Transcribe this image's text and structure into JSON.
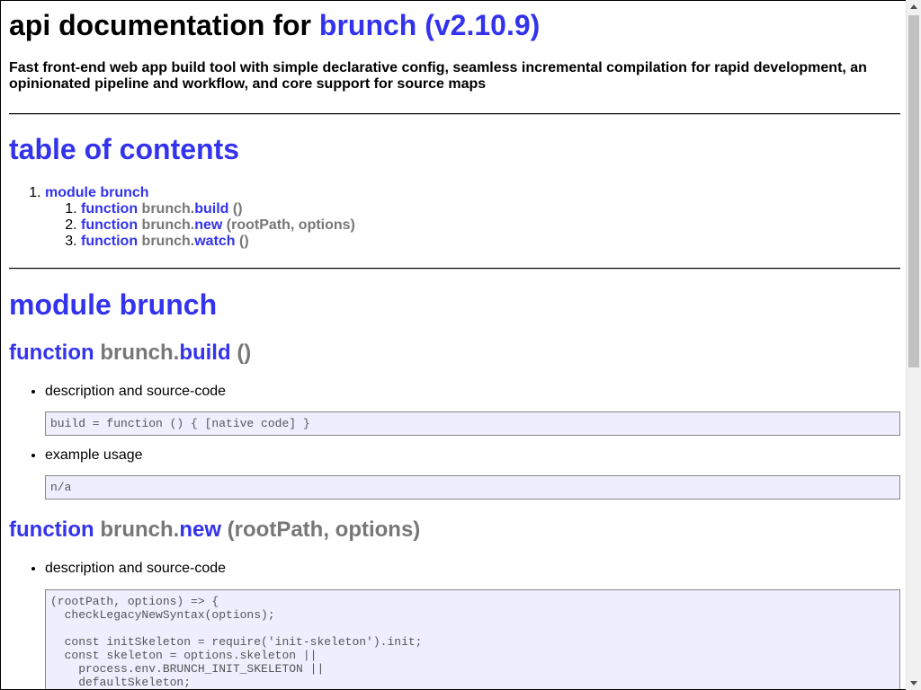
{
  "title": {
    "prefix": "api documentation for",
    "module_link": "brunch",
    "version": "(v2.10.9)"
  },
  "description": "Fast front-end web app build tool with simple declarative config, seamless incremental compilation for rapid development, an opinionated pipeline and workflow, and core support for source maps",
  "toc": {
    "heading": "table of contents",
    "module_item": "module brunch",
    "items": [
      {
        "kw": "function",
        "obj": "brunch.",
        "name": "build",
        "sig": "()"
      },
      {
        "kw": "function",
        "obj": "brunch.",
        "name": "new",
        "sig": "(rootPath, options)"
      },
      {
        "kw": "function",
        "obj": "brunch.",
        "name": "watch",
        "sig": "()"
      }
    ]
  },
  "module": {
    "heading": "module brunch",
    "functions": [
      {
        "kw": "function",
        "obj": "brunch.",
        "name": "build",
        "sig": "()",
        "desc_label": "description and source-code",
        "source": "build = function () { [native code] }",
        "example_label": "example usage",
        "example": "n/a"
      },
      {
        "kw": "function",
        "obj": "brunch.",
        "name": "new",
        "sig": "(rootPath, options)",
        "desc_label": "description and source-code",
        "source": "(rootPath, options) => {\n  checkLegacyNewSyntax(options);\n\n  const initSkeleton = require('init-skeleton').init;\n  const skeleton = options.skeleton ||\n    process.env.BRUNCH_INIT_SKELETON ||\n    defaultSkeleton;"
      }
    ]
  },
  "colors": {
    "link": "#3333ee",
    "muted": "#777777",
    "code_bg": "#eeeeff"
  }
}
